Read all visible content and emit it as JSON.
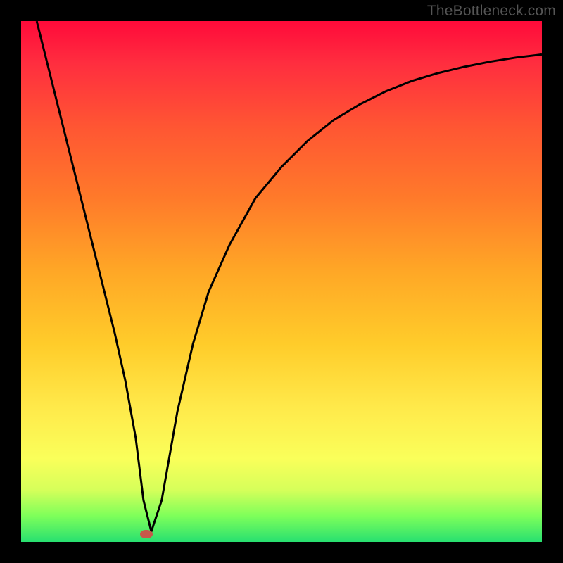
{
  "watermark": "TheBottleneck.com",
  "chart_data": {
    "type": "line",
    "title": "",
    "xlabel": "",
    "ylabel": "",
    "x_range": [
      0,
      100
    ],
    "y_range": [
      0,
      100
    ],
    "series": [
      {
        "name": "bottleneck-curve",
        "x": [
          3,
          5,
          8,
          10,
          12,
          15,
          18,
          20,
          22,
          23.5,
          25,
          27,
          30,
          33,
          36,
          40,
          45,
          50,
          55,
          60,
          65,
          70,
          75,
          80,
          85,
          90,
          95,
          100
        ],
        "y": [
          100,
          92,
          80,
          72,
          64,
          52,
          40,
          31,
          20,
          8,
          2,
          8,
          25,
          38,
          48,
          57,
          66,
          72,
          77,
          81,
          84,
          86.5,
          88.5,
          90,
          91.2,
          92.2,
          93,
          93.6
        ]
      }
    ],
    "marker": {
      "x": 24,
      "y": 1.5,
      "label": "optimal-point"
    },
    "gradient_stops": [
      {
        "pos": 0,
        "color": "#ff0a3a"
      },
      {
        "pos": 50,
        "color": "#ffcc2a"
      },
      {
        "pos": 100,
        "color": "#28e070"
      }
    ]
  }
}
